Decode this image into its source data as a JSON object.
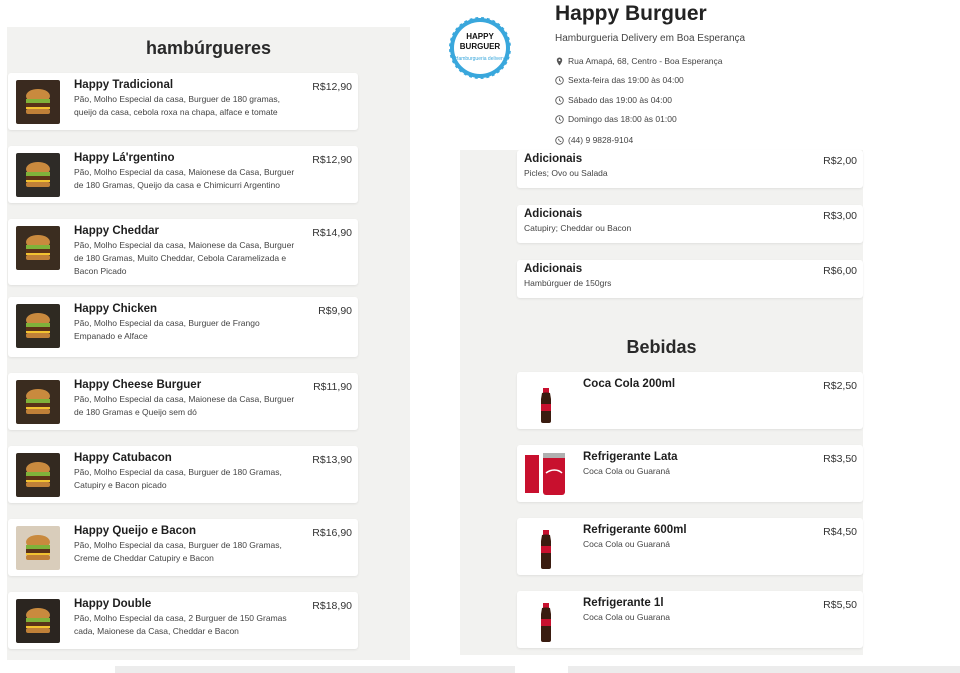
{
  "store": {
    "name": "Happy Burguer",
    "tagline": "Hamburgueria Delivery em Boa Esperança",
    "logo_line1": "HAPPY",
    "logo_line2": "BURGUER",
    "logo_line3": "Hamburgueria delivery",
    "address": "Rua Amapá, 68, Centro - Boa Esperança",
    "hours": [
      "Sexta-feira das 19:00 às 04:00",
      "Sábado das 19:00 às 04:00",
      "Domingo das 18:00 às 01:00"
    ],
    "phone": "(44) 9 9828-9104"
  },
  "burgers_section": {
    "title": "hambúrgueres",
    "items": [
      {
        "name": "Happy Tradicional",
        "desc": "Pão, Molho Especial da casa, Burguer de 180 gramas, queijo da casa, cebola roxa na chapa, alface e tomate",
        "price": "R$12,90"
      },
      {
        "name": "Happy Lá'rgentino",
        "desc": "Pão, Molho Especial da casa, Maionese da Casa, Burguer de 180 Gramas, Queijo da casa e Chimicurri Argentino",
        "price": "R$12,90"
      },
      {
        "name": "Happy Cheddar",
        "desc": "Pão, Molho Especial da casa, Maionese da Casa, Burguer de 180 Gramas, Muito Cheddar, Cebola Caramelizada e Bacon Picado",
        "price": "R$14,90"
      },
      {
        "name": "Happy Chicken",
        "desc": "Pão, Molho Especial da casa, Burguer de Frango Empanado e Alface",
        "price": "R$9,90"
      },
      {
        "name": "Happy Cheese Burguer",
        "desc": "Pão, Molho Especial da casa, Maionese da Casa, Burguer de 180 Gramas e Queijo sem dó",
        "price": "R$11,90"
      },
      {
        "name": "Happy Catubacon",
        "desc": "Pão, Molho Especial da casa, Burguer de 180 Gramas, Catupiry e Bacon picado",
        "price": "R$13,90"
      },
      {
        "name": "Happy Queijo e Bacon",
        "desc": "Pão, Molho Especial da casa, Burguer de 180 Gramas, Creme de Cheddar Catupiry e Bacon",
        "price": "R$16,90"
      },
      {
        "name": "Happy Double",
        "desc": "Pão, Molho Especial da casa, 2 Burguer de 150 Gramas cada, Maionese da Casa, Cheddar e Bacon",
        "price": "R$18,90"
      }
    ]
  },
  "extras": [
    {
      "name": "Adicionais",
      "desc": "Picles; Ovo ou Salada",
      "price": "R$2,00"
    },
    {
      "name": "Adicionais",
      "desc": "Catupiry; Cheddar ou Bacon",
      "price": "R$3,00"
    },
    {
      "name": "Adicionais",
      "desc": "Hambúrguer de 150grs",
      "price": "R$6,00"
    }
  ],
  "drinks_section": {
    "title": "Bebidas",
    "items": [
      {
        "name": "Coca Cola 200ml",
        "desc": "",
        "price": "R$2,50"
      },
      {
        "name": "Refrigerante Lata",
        "desc": "Coca Cola ou Guaraná",
        "price": "R$3,50"
      },
      {
        "name": "Refrigerante 600ml",
        "desc": "Coca Cola ou Guaraná",
        "price": "R$4,50"
      },
      {
        "name": "Refrigerante 1l",
        "desc": "Coca Cola ou Guarana",
        "price": "R$5,50"
      }
    ]
  },
  "colors": {
    "logo_ring": "#39a7dc",
    "panel_bg": "#f2f2f0",
    "coke_red": "#c8102e"
  }
}
